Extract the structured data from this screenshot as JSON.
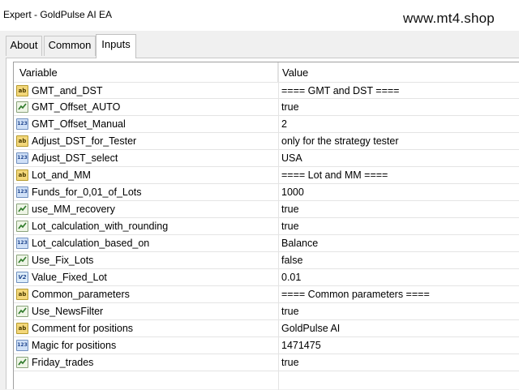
{
  "window": {
    "title": "Expert - GoldPulse AI EA",
    "watermark": "www.mt4.shop"
  },
  "tabs": [
    {
      "label": "About",
      "active": false
    },
    {
      "label": "Common",
      "active": false
    },
    {
      "label": "Inputs",
      "active": true
    }
  ],
  "table": {
    "headers": {
      "variable": "Variable",
      "value": "Value"
    },
    "rows": [
      {
        "icon": "string-ab-icon",
        "type": "string",
        "name": "GMT_and_DST",
        "value": "==== GMT and DST ===="
      },
      {
        "icon": "bool-chart-icon",
        "type": "bool",
        "name": "GMT_Offset_AUTO",
        "value": "true"
      },
      {
        "icon": "int-123-icon",
        "type": "int",
        "name": "GMT_Offset_Manual",
        "value": "2"
      },
      {
        "icon": "string-ab-icon",
        "type": "string",
        "name": "Adjust_DST_for_Tester",
        "value": "only for the strategy tester"
      },
      {
        "icon": "int-123-icon",
        "type": "int",
        "name": "Adjust_DST_select",
        "value": "USA"
      },
      {
        "icon": "string-ab-icon",
        "type": "string",
        "name": "Lot_and_MM",
        "value": "==== Lot and MM ===="
      },
      {
        "icon": "int-123-icon",
        "type": "int",
        "name": "Funds_for_0,01_of_Lots",
        "value": "1000"
      },
      {
        "icon": "bool-chart-icon",
        "type": "bool",
        "name": "use_MM_recovery",
        "value": "true"
      },
      {
        "icon": "bool-chart-icon",
        "type": "bool",
        "name": "Lot_calculation_with_rounding",
        "value": "true"
      },
      {
        "icon": "int-123-icon",
        "type": "int",
        "name": "Lot_calculation_based_on",
        "value": "Balance"
      },
      {
        "icon": "bool-chart-icon",
        "type": "bool",
        "name": "Use_Fix_Lots",
        "value": "false"
      },
      {
        "icon": "double-v2-icon",
        "type": "double",
        "name": "Value_Fixed_Lot",
        "value": "0.01"
      },
      {
        "icon": "string-ab-icon",
        "type": "string",
        "name": "Common_parameters",
        "value": "==== Common parameters ===="
      },
      {
        "icon": "bool-chart-icon",
        "type": "bool",
        "name": "Use_NewsFilter",
        "value": "true"
      },
      {
        "icon": "string-ab-icon",
        "type": "string",
        "name": "Comment for positions",
        "value": "GoldPulse AI"
      },
      {
        "icon": "int-123-icon",
        "type": "int",
        "name": "Magic for positions",
        "value": "1471475"
      },
      {
        "icon": "bool-chart-icon",
        "type": "bool",
        "name": "Friday_trades",
        "value": "true"
      }
    ]
  }
}
